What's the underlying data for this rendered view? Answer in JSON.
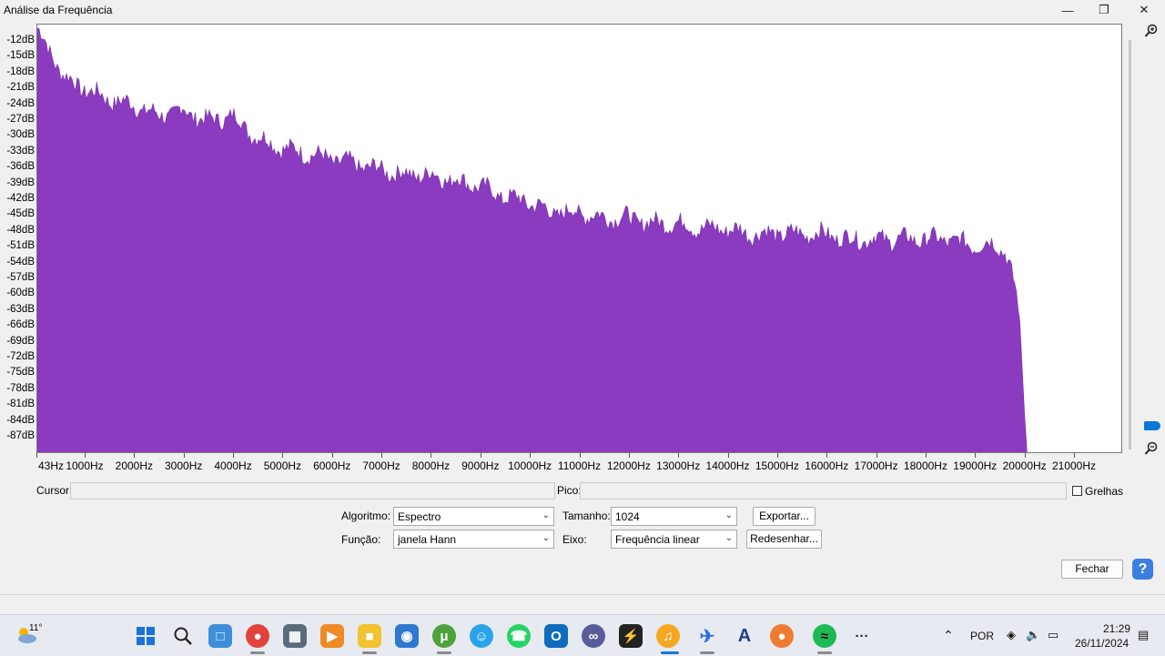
{
  "window": {
    "title": "Análise da Frequência"
  },
  "y_ticks": [
    "-12dB",
    "-15dB",
    "-18dB",
    "-21dB",
    "-24dB",
    "-27dB",
    "-30dB",
    "-33dB",
    "-36dB",
    "-39dB",
    "-42dB",
    "-45dB",
    "-48dB",
    "-51dB",
    "-54dB",
    "-57dB",
    "-60dB",
    "-63dB",
    "-66dB",
    "-69dB",
    "-72dB",
    "-75dB",
    "-78dB",
    "-81dB",
    "-84dB",
    "-87dB"
  ],
  "x_ticks": [
    "43Hz",
    "1000Hz",
    "2000Hz",
    "3000Hz",
    "4000Hz",
    "5000Hz",
    "6000Hz",
    "7000Hz",
    "8000Hz",
    "9000Hz",
    "10000Hz",
    "11000Hz",
    "12000Hz",
    "13000Hz",
    "14000Hz",
    "15000Hz",
    "16000Hz",
    "17000Hz",
    "18000Hz",
    "19000Hz",
    "20000Hz",
    "21000Hz"
  ],
  "chart_data": {
    "type": "area",
    "x": [
      43,
      300,
      600,
      1000,
      1500,
      2000,
      2500,
      3000,
      3500,
      4000,
      4500,
      5000,
      5500,
      6000,
      6500,
      7000,
      7500,
      8000,
      8500,
      9000,
      9500,
      10000,
      10500,
      11000,
      11500,
      12000,
      12500,
      13000,
      13500,
      14000,
      14500,
      15000,
      15500,
      16000,
      16500,
      17000,
      17500,
      18000,
      18500,
      19000,
      19500,
      19700,
      19800,
      19900,
      20000,
      20050,
      20100,
      20150
    ],
    "y": [
      -12,
      -16,
      -21,
      -23,
      -25,
      -26,
      -28,
      -27,
      -29,
      -28,
      -32,
      -34,
      -35,
      -36,
      -37,
      -38,
      -39,
      -39,
      -40,
      -41,
      -43,
      -44,
      -46,
      -46,
      -47,
      -47,
      -48,
      -48,
      -49,
      -49,
      -50,
      -50,
      -50,
      -50,
      -51,
      -51,
      -51,
      -51,
      -51,
      -52,
      -52,
      -53,
      -56,
      -60,
      -66,
      -75,
      -84,
      -91
    ],
    "ylim": [
      -91,
      -11
    ],
    "xlim": [
      43,
      22100
    ],
    "color": "#8a3bbf",
    "grid": false
  },
  "controls": {
    "cursor_label": "Cursor:",
    "peak_label": "Pico:",
    "grid_label": "Grelhas",
    "algorithm_label": "Algoritmo:",
    "algorithm_value": "Espectro",
    "function_label": "Função:",
    "function_value": "janela Hann",
    "size_label": "Tamanho:",
    "size_value": "1024",
    "axis_label": "Eixo:",
    "axis_value": "Frequência linear",
    "export_label": "Exportar...",
    "redraw_label": "Redesenhar...",
    "close_label": "Fechar",
    "help_label": "?"
  },
  "taskbar": {
    "weather_temp": "11°",
    "language": "POR",
    "time": "21:29",
    "date": "26/11/2024",
    "more": "···"
  }
}
